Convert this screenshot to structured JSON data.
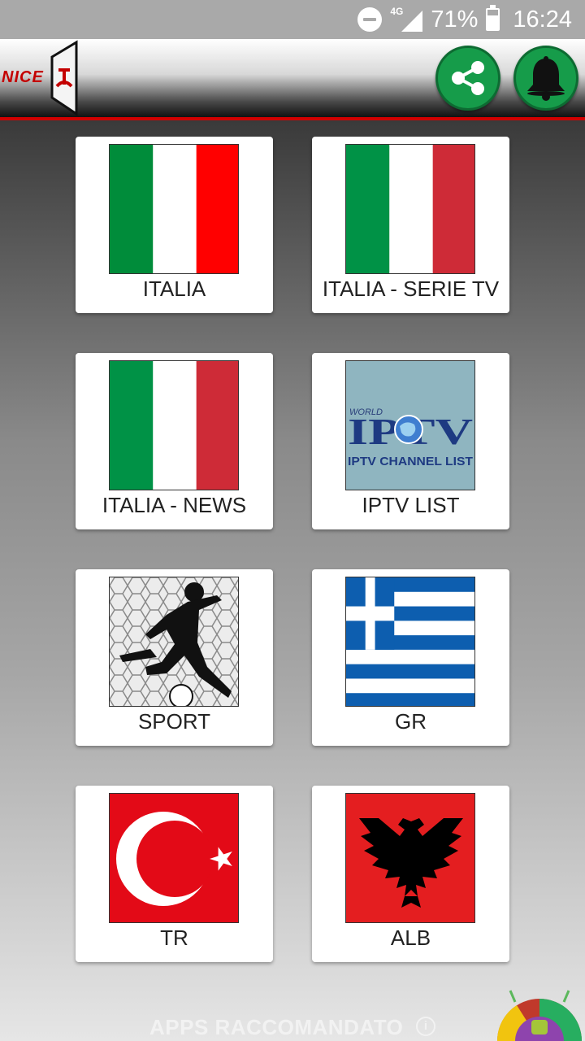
{
  "status_bar": {
    "network": "4G",
    "battery": "71%",
    "battery_level": 0.71,
    "time": "16:24"
  },
  "app_bar": {
    "logo_text": "NICE",
    "share_icon": "share-icon",
    "bell_icon": "bell-icon",
    "accent": "#169c4a",
    "border_color": "#d10000"
  },
  "grid": {
    "items": [
      {
        "label": "ITALIA",
        "icon": "italy-flag"
      },
      {
        "label": "ITALIA - SERIE TV",
        "icon": "italy-flag"
      },
      {
        "label": "ITALIA - NEWS",
        "icon": "italy-flag"
      },
      {
        "label": "IPTV LIST",
        "icon": "world-iptv-logo",
        "logo_lines": [
          "WORLD",
          "IPTV",
          "IPTV CHANNEL LIST"
        ]
      },
      {
        "label": "SPORT",
        "icon": "soccer-player-image"
      },
      {
        "label": "GR",
        "icon": "greece-flag"
      },
      {
        "label": "TR",
        "icon": "turkey-flag"
      },
      {
        "label": "ALB",
        "icon": "albania-flag"
      }
    ]
  },
  "footer": {
    "text": "APPS RACCOMANDATO",
    "info_icon": "info-icon"
  }
}
